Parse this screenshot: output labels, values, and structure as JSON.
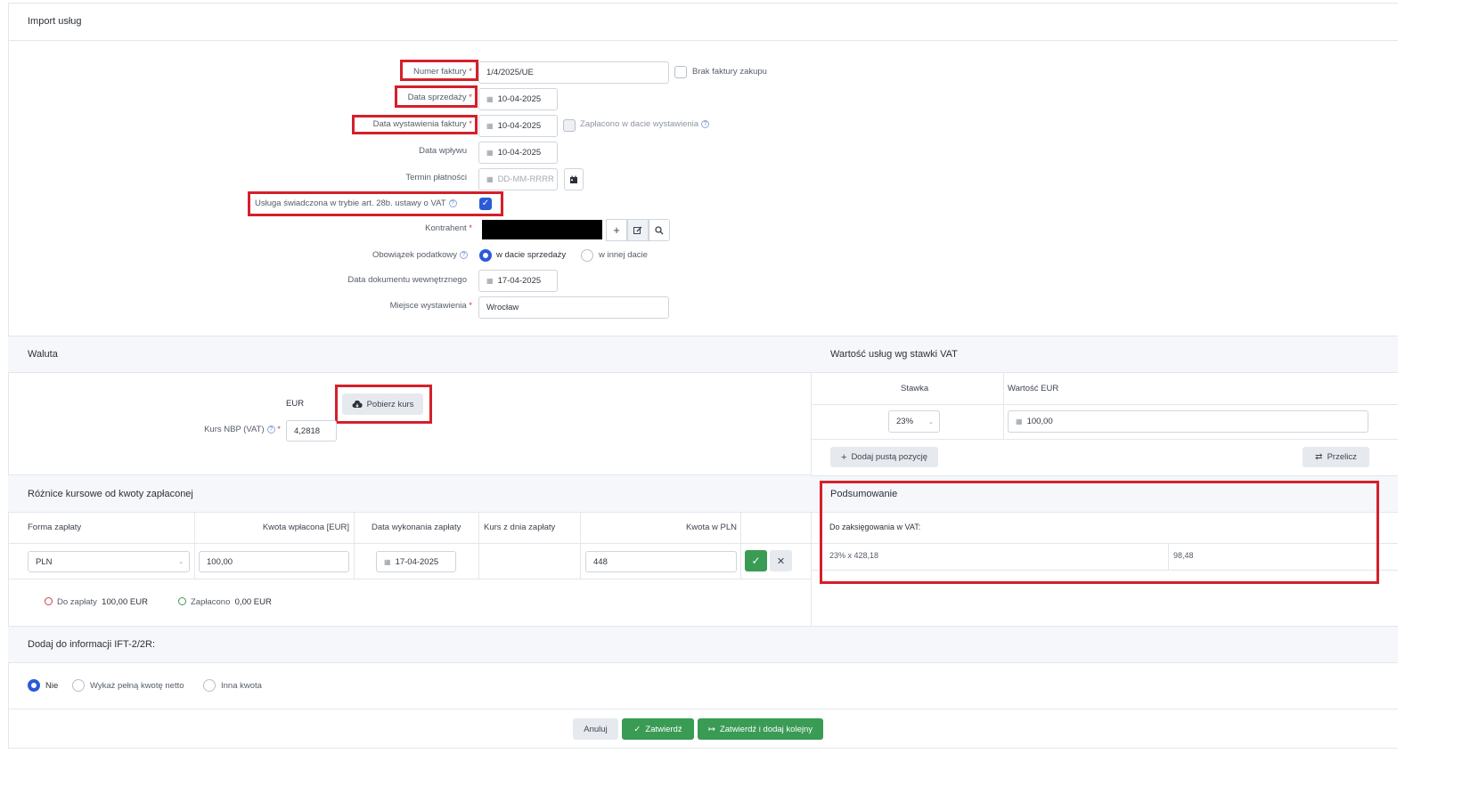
{
  "title": "Import usług",
  "form": {
    "invoice_number": {
      "label": "Numer faktury",
      "req": "*",
      "value": "1/4/2025/UE"
    },
    "no_invoice": {
      "label": "Brak faktury zakupu"
    },
    "sale_date": {
      "label": "Data sprzedaży",
      "req": "*",
      "value": "10-04-2025"
    },
    "issue_date": {
      "label": "Data wystawienia faktury",
      "req": "*",
      "value": "10-04-2025"
    },
    "paid_on_issue": {
      "label": "Zapłacono w dacie wystawienia"
    },
    "receipt_date": {
      "label": "Data wpływu",
      "value": "10-04-2025"
    },
    "payment_term": {
      "label": "Termin płatności",
      "placeholder": "DD-MM-RRRR"
    },
    "art28b": {
      "label": "Usługa świadczona w trybie art. 28b. ustawy o VAT",
      "checked": true
    },
    "contractor": {
      "label": "Kontrahent",
      "req": "*"
    },
    "tax_obligation": {
      "label": "Obowiązek podatkowy",
      "opt1": "w dacie sprzedaży",
      "opt2": "w innej dacie"
    },
    "internal_doc_date": {
      "label": "Data dokumentu wewnętrznego",
      "value": "17-04-2025"
    },
    "place": {
      "label": "Miejsce wystawienia",
      "req": "*",
      "value": "Wrocław"
    }
  },
  "currency": {
    "title": "Waluta",
    "code": "EUR",
    "fetch_btn": "Pobierz kurs",
    "rate_label": "Kurs NBP (VAT)",
    "req": "*",
    "rate_value": "4,2818"
  },
  "vat_values": {
    "title": "Wartość usług wg stawki VAT",
    "col_rate": "Stawka",
    "col_value": "Wartość EUR",
    "rate": "23%",
    "value": "100,00",
    "add_btn": "Dodaj pustą pozycję",
    "recalc_btn": "Przelicz"
  },
  "summary": {
    "title": "Podsumowanie",
    "subtitle": "Do zaksięgowania w VAT:",
    "row_label": "23% x 428,18",
    "row_value": "98,48"
  },
  "exchange": {
    "title": "Różnice kursowe od kwoty zapłaconej",
    "cols": [
      "Forma zapłaty",
      "Kwota wpłacona [EUR]",
      "Data wykonania zapłaty",
      "Kurs z dnia zapłaty",
      "Kwota w PLN"
    ],
    "form": "PLN",
    "amount": "100,00",
    "date": "17-04-2025",
    "pln": "448",
    "to_pay_label": "Do zapłaty",
    "to_pay_value": "100,00 EUR",
    "paid_label": "Zapłacono",
    "paid_value": "0,00 EUR"
  },
  "ift": {
    "title": "Dodaj do informacji IFT-2/2R:",
    "opt1": "Nie",
    "opt2": "Wykaż pełną kwotę netto",
    "opt3": "Inna kwota"
  },
  "footer": {
    "cancel": "Anuluj",
    "confirm": "Zatwierdź",
    "confirm_next": "Zatwierdź i dodaj kolejny"
  }
}
